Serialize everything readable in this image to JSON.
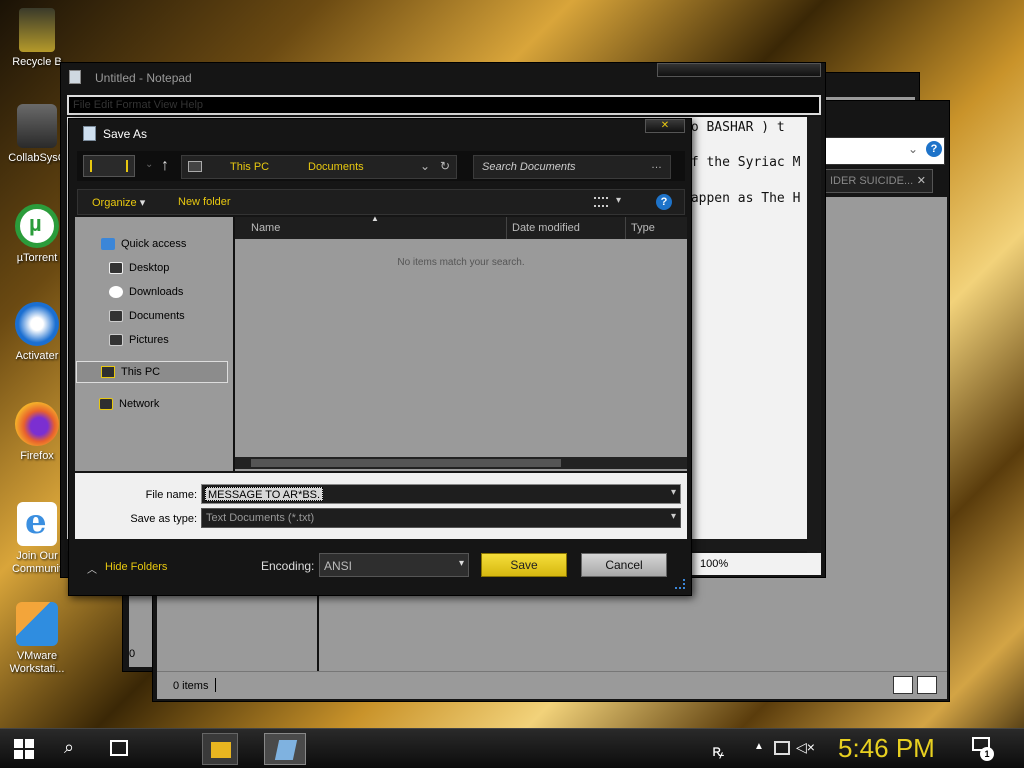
{
  "desktop": {
    "icons": [
      {
        "label": "Recycle B",
        "color": "#b59a2a"
      },
      {
        "label": "CollabSysC",
        "color": "#5a5a5a"
      },
      {
        "label": "µTorrent",
        "color": "#2b9c3b"
      },
      {
        "label": "Activater",
        "color": "#1b6fd1"
      },
      {
        "label": "Firefox",
        "color": "#e8612c"
      },
      {
        "label": "Join Our",
        "label2": "Communit",
        "color": "#3b8fe0"
      },
      {
        "label": "VMware",
        "label2": "Workstati...",
        "color": "#2f8de0"
      }
    ]
  },
  "bg_window": {
    "button_label": "IDER SUICIDE...",
    "status_items": "0 items",
    "zero_left": "0"
  },
  "notepad": {
    "title": "Untitled - Notepad",
    "menu": "File  Edit  Format  View  Help",
    "lines": [
      "do BASHAR  )  t",
      "of the Syriac M",
      "happen as The H"
    ],
    "zoom": "100%"
  },
  "dialog": {
    "title": "Save As",
    "breadcrumb": [
      "This PC",
      "Documents"
    ],
    "search_placeholder": "Search Documents",
    "toolbar": {
      "organize": "Organize",
      "new_folder": "New folder"
    },
    "nav": {
      "quick_access": "Quick access",
      "desktop": "Desktop",
      "downloads": "Downloads",
      "documents": "Documents",
      "pictures": "Pictures",
      "this_pc": "This PC",
      "network": "Network"
    },
    "columns": {
      "name": "Name",
      "date": "Date modified",
      "type": "Type"
    },
    "empty_message": "No items match your search.",
    "file_name_label": "File name:",
    "file_name_value": "MESSAGE TO AR*BS.",
    "save_type_label": "Save as type:",
    "save_type_value": "Text Documents (*.txt)",
    "hide_folders": "Hide Folders",
    "encoding_label": "Encoding:",
    "encoding_value": "ANSI",
    "save": "Save",
    "cancel": "Cancel"
  },
  "taskbar": {
    "time": "5:46 PM",
    "notification_count": "1",
    "colors": {
      "clock": "#e8d020",
      "accent": "#e8c810"
    }
  }
}
